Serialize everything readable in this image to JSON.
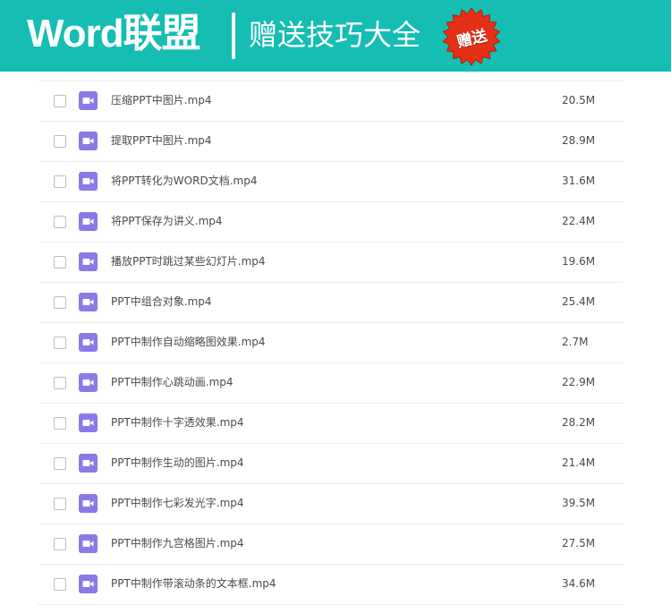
{
  "banner": {
    "logo": "Word联盟",
    "subtitle": "赠送技巧大全",
    "badge": "赠送",
    "background_color": "#15bdb2",
    "badge_color": "#e53018"
  },
  "files": [
    {
      "name": "压缩PPT中图片.mp4",
      "size": "20.5M"
    },
    {
      "name": "提取PPT中图片.mp4",
      "size": "28.9M"
    },
    {
      "name": "将PPT转化为WORD文档.mp4",
      "size": "31.6M"
    },
    {
      "name": "将PPT保存为讲义.mp4",
      "size": "22.4M"
    },
    {
      "name": "播放PPT时跳过某些幻灯片.mp4",
      "size": "19.6M"
    },
    {
      "name": "PPT中组合对象.mp4",
      "size": "25.4M"
    },
    {
      "name": "PPT中制作自动缩略图效果.mp4",
      "size": "2.7M"
    },
    {
      "name": "PPT中制作心跳动画.mp4",
      "size": "22.9M"
    },
    {
      "name": "PPT中制作十字透效果.mp4",
      "size": "28.2M"
    },
    {
      "name": "PPT中制作生动的图片.mp4",
      "size": "21.4M"
    },
    {
      "name": "PPT中制作七彩发光字.mp4",
      "size": "39.5M"
    },
    {
      "name": "PPT中制作九宫格图片.mp4",
      "size": "27.5M"
    },
    {
      "name": "PPT中制作带滚动条的文本框.mp4",
      "size": "34.6M"
    }
  ],
  "file_icon": "video-file-icon"
}
